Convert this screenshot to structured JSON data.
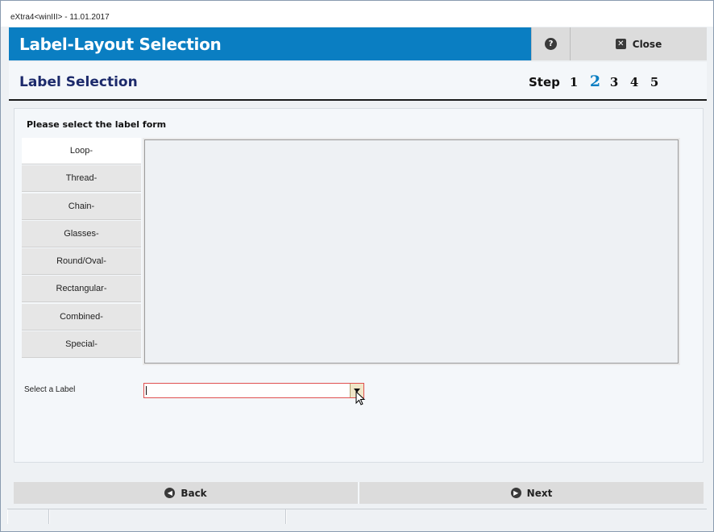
{
  "window": {
    "title": "eXtra4<winIII>  -  11.01.2017"
  },
  "header": {
    "title": "Label-Layout Selection",
    "help_icon": "question-circle-icon",
    "close_icon": "close-x-icon",
    "close_label": "Close",
    "color": "#0a7ec2"
  },
  "subheader": {
    "title": "Label Selection",
    "step_label": "Step",
    "steps": [
      "1",
      "2",
      "3",
      "4",
      "5"
    ],
    "active_step": "2"
  },
  "content": {
    "heading": "Please select the label form",
    "forms": [
      {
        "label": "Loop-",
        "selected": true
      },
      {
        "label": "Thread-",
        "selected": false
      },
      {
        "label": "Chain-",
        "selected": false
      },
      {
        "label": "Glasses-",
        "selected": false
      },
      {
        "label": "Round/Oval-",
        "selected": false
      },
      {
        "label": "Rectangular-",
        "selected": false
      },
      {
        "label": "Combined-",
        "selected": false
      },
      {
        "label": "Special-",
        "selected": false
      }
    ],
    "select_label": "Select a Label",
    "select_value": ""
  },
  "footer": {
    "back_label": "Back",
    "back_icon": "arrow-left-circle-icon",
    "next_label": "Next",
    "next_icon": "arrow-right-circle-icon"
  }
}
